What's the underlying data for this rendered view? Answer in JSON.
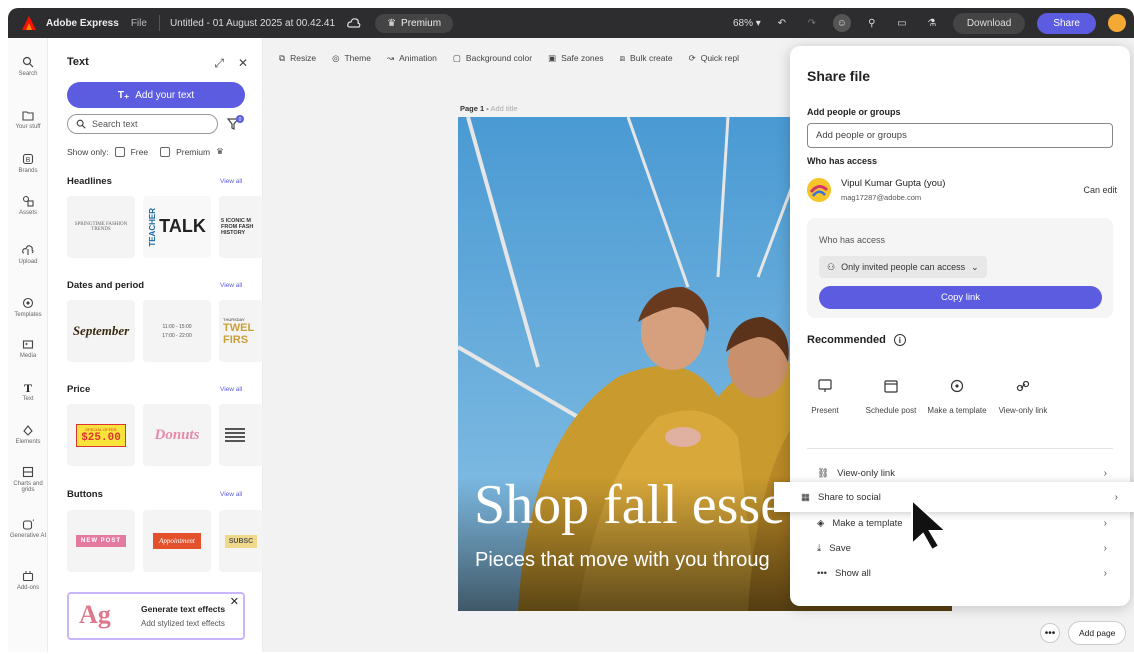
{
  "topbar": {
    "app_name": "Adobe Express",
    "file_menu": "File",
    "doc_title": "Untitled - 01 August 2025 at 00.42.41",
    "premium": "Premium",
    "zoom": "68%",
    "download": "Download",
    "share": "Share"
  },
  "rail": {
    "items": [
      {
        "label": "Search",
        "icon": "search-icon"
      },
      {
        "label": "Your stuff",
        "icon": "folder-icon"
      },
      {
        "label": "Brands",
        "icon": "brand-icon"
      },
      {
        "label": "Assets",
        "icon": "assets-icon"
      },
      {
        "label": "Upload",
        "icon": "upload-icon"
      },
      {
        "label": "Templates",
        "icon": "templates-icon"
      },
      {
        "label": "Media",
        "icon": "media-icon"
      },
      {
        "label": "Text",
        "icon": "text-icon"
      },
      {
        "label": "Elements",
        "icon": "elements-icon"
      },
      {
        "label": "Charts and grids",
        "icon": "charts-icon"
      },
      {
        "label": "Generative AI",
        "icon": "ai-icon"
      },
      {
        "label": "Add-ons",
        "icon": "addons-icon"
      }
    ]
  },
  "text_panel": {
    "title": "Text",
    "add_text": "Add your text",
    "search_placeholder": "Search text",
    "show_only": "Show only:",
    "free": "Free",
    "premium": "Premium",
    "view_all": "View all",
    "sections": {
      "headlines": "Headlines",
      "dates": "Dates and period",
      "price": "Price",
      "buttons": "Buttons"
    },
    "thumbs": {
      "h1": "SPRINGTIME FASHION TRENDS",
      "h2a": "TEACHER",
      "h2b": "TALK",
      "h3": "5 ICONIC M FROM FASH HISTORY",
      "d1": "September",
      "d2a": "11:00 - 15:00",
      "d2b": "17:00 - 22:00",
      "d3a": "THURSDAY",
      "d3b": "TWEL FIRS",
      "p1a": "SPECIAL OFFER",
      "p1b": "$25.00",
      "p2": "Donuts",
      "b1": "NEW POST",
      "b2": "Appointment",
      "b3": "SUBSC"
    },
    "gen_effects_title": "Generate text effects",
    "gen_effects_sub": "Add stylized text effects",
    "gen_effects_thumb": "Ag"
  },
  "toolbar": {
    "resize": "Resize",
    "theme": "Theme",
    "animation": "Animation",
    "background": "Background color",
    "safe_zones": "Safe zones",
    "bulk_create": "Bulk create",
    "quick": "Quick repl"
  },
  "canvas": {
    "page_label": "Page 1 -",
    "page_title_placeholder": "Add title",
    "headline": "Shop fall esse",
    "subline": "Pieces that move with you throug"
  },
  "share_panel": {
    "title": "Share file",
    "add_people_label": "Add people or groups",
    "add_people_placeholder": "Add people or groups",
    "who_has_access": "Who has access",
    "user_name": "Vipul Kumar Gupta (you)",
    "user_email": "mag17287@adobe.com",
    "user_perm": "Can edit",
    "access_box_label": "Who has access",
    "access_select": "Only invited people can access",
    "copy_link": "Copy link",
    "recommended": "Recommended",
    "rec_items": [
      {
        "label": "Present",
        "icon": "present-icon"
      },
      {
        "label": "Schedule post",
        "icon": "calendar-icon"
      },
      {
        "label": "Make a template",
        "icon": "template-icon"
      },
      {
        "label": "View-only link",
        "icon": "link-icon"
      }
    ],
    "rows": [
      {
        "label": "View-only link",
        "icon": "link-icon"
      },
      {
        "label": "Share to social",
        "icon": "social-icon"
      },
      {
        "label": "Make a template",
        "icon": "template-icon"
      },
      {
        "label": "Save",
        "icon": "download-icon"
      },
      {
        "label": "Show all",
        "icon": "more-icon"
      }
    ]
  },
  "bottom": {
    "more": "•••",
    "add_page": "Add page"
  },
  "colors": {
    "accent": "#5c5ce0",
    "topbar": "#2d2d30",
    "sky": "#5aa6d8"
  }
}
